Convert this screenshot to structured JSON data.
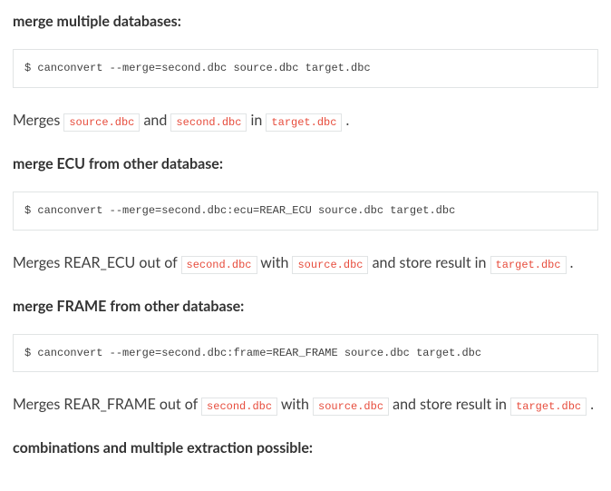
{
  "sections": [
    {
      "heading": "merge multiple databases:",
      "code": "$ canconvert --merge=second.dbc source.dbc target.dbc",
      "desc_parts": [
        "Merges ",
        " and ",
        " in ",
        "."
      ],
      "inlines": [
        "source.dbc",
        "second.dbc",
        "target.dbc"
      ]
    },
    {
      "heading": "merge ECU from other database:",
      "code": "$ canconvert --merge=second.dbc:ecu=REAR_ECU source.dbc target.dbc",
      "desc_parts": [
        "Merges REAR_ECU out of ",
        " with ",
        " and store result in ",
        "."
      ],
      "inlines": [
        "second.dbc",
        "source.dbc",
        "target.dbc"
      ]
    },
    {
      "heading": "merge FRAME from other database:",
      "code": "$ canconvert --merge=second.dbc:frame=REAR_FRAME source.dbc target.dbc",
      "desc_parts": [
        "Merges REAR_FRAME out of ",
        " with ",
        " and store result in ",
        "."
      ],
      "inlines": [
        "second.dbc",
        "source.dbc",
        "target.dbc"
      ]
    },
    {
      "heading": "combinations and multiple extraction possible:"
    }
  ]
}
